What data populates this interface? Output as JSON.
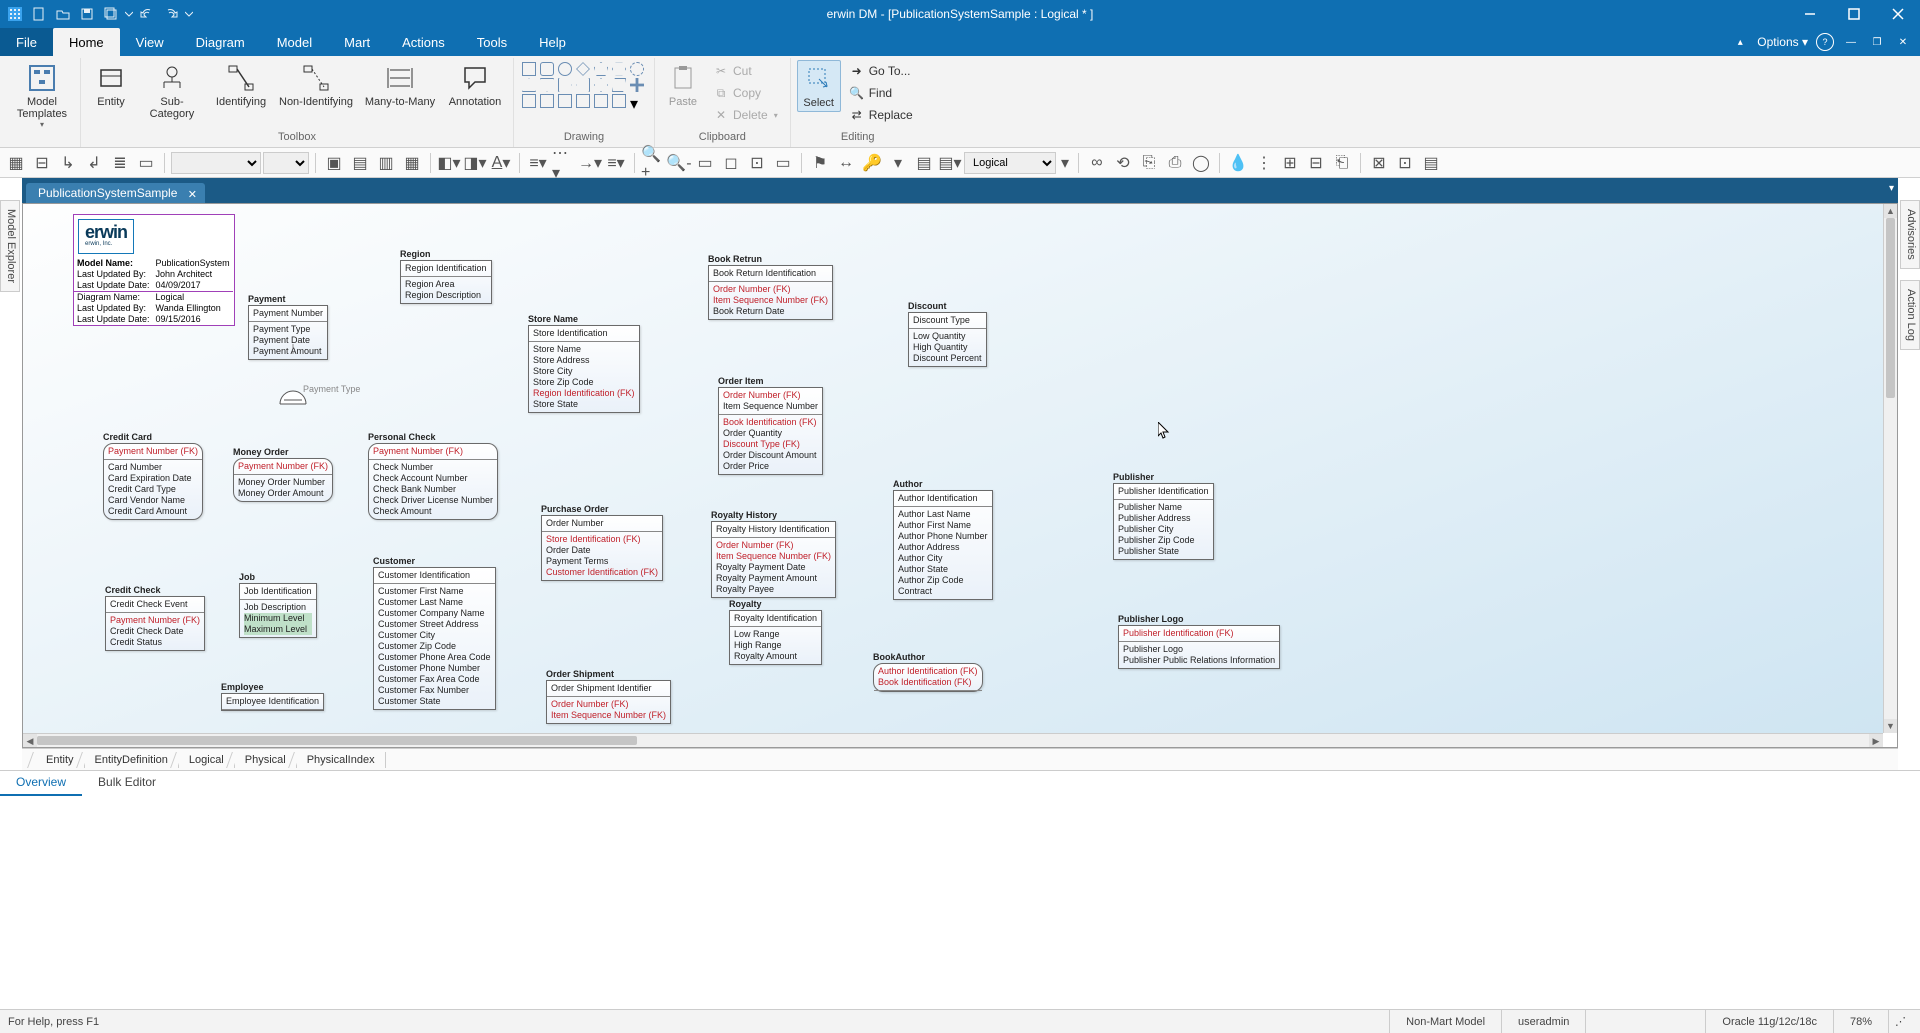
{
  "app": {
    "title": "erwin DM - [PublicationSystemSample : Logical * ]",
    "options_label": "Options"
  },
  "menus": {
    "file": "File",
    "home": "Home",
    "view": "View",
    "diagram": "Diagram",
    "model": "Model",
    "mart": "Mart",
    "actions": "Actions",
    "tools": "Tools",
    "help": "Help"
  },
  "ribbon": {
    "model_templates": "Model\nTemplates",
    "entity": "Entity",
    "sub_category": "Sub-Category",
    "identifying": "Identifying",
    "non_identifying": "Non-Identifying",
    "many_to_many": "Many-to-Many",
    "annotation": "Annotation",
    "toolbox_label": "Toolbox",
    "drawing_label": "Drawing",
    "paste": "Paste",
    "cut": "Cut",
    "copy": "Copy",
    "delete": "Delete",
    "clipboard_label": "Clipboard",
    "select": "Select",
    "goto": "Go To...",
    "find": "Find",
    "replace": "Replace",
    "editing_label": "Editing"
  },
  "toolbar2": {
    "view_dropdown": "Logical"
  },
  "side_panels": {
    "model_explorer": "Model Explorer",
    "advisories": "Advisories",
    "action_log": "Action Log"
  },
  "doc_tab": "PublicationSystemSample",
  "info_box": {
    "logo_text": "erwin",
    "logo_sub": "erwin, Inc.",
    "rows": [
      [
        "Model Name:",
        "PublicationSystem"
      ],
      [
        "Last Updated By:",
        "John Architect"
      ],
      [
        "Last Update Date:",
        "04/09/2017"
      ],
      [
        "Diagram Name:",
        "Logical"
      ],
      [
        "Last Updated By:",
        "Wanda Ellington"
      ],
      [
        "Last Update Date:",
        "09/15/2016"
      ]
    ]
  },
  "free_label": {
    "payment_type": "Payment Type"
  },
  "entities": {
    "region": {
      "name": "Region",
      "pk": [
        "Region Identification"
      ],
      "attrs": [
        "Region Area",
        "Region Description"
      ]
    },
    "payment": {
      "name": "Payment",
      "pk": [
        "Payment Number"
      ],
      "attrs": [
        "Payment Type",
        "Payment Date",
        "Payment Amount"
      ]
    },
    "store": {
      "name": "Store Name",
      "pk": [
        "Store Identification"
      ],
      "attrs": [
        "Store Name",
        "Store Address",
        "Store City",
        "Store Zip Code",
        {
          "t": "Region Identification (FK)",
          "fk": true
        },
        "Store State"
      ]
    },
    "book_return": {
      "name": "Book Retrun",
      "pk": [
        "Book Return Identification"
      ],
      "attrs": [
        {
          "t": "Order Number (FK)",
          "fk": true
        },
        {
          "t": "Item Sequence Number (FK)",
          "fk": true
        },
        "Book Return Date"
      ]
    },
    "discount": {
      "name": "Discount",
      "pk": [
        "Discount Type"
      ],
      "attrs": [
        "Low Quantity",
        "High Quantity",
        "Discount Percent"
      ]
    },
    "credit_card": {
      "name": "Credit Card",
      "pk": [
        {
          "t": "Payment Number (FK)",
          "fk": true
        }
      ],
      "attrs": [
        "Card Number",
        "Card Expiration Date",
        "Credit Card Type",
        "Card Vendor Name",
        "Credit Card Amount"
      ]
    },
    "money_order": {
      "name": "Money Order",
      "pk": [
        {
          "t": "Payment Number (FK)",
          "fk": true
        }
      ],
      "attrs": [
        "Money Order Number",
        "Money Order Amount"
      ]
    },
    "personal_check": {
      "name": "Personal Check",
      "pk": [
        {
          "t": "Payment Number (FK)",
          "fk": true
        }
      ],
      "attrs": [
        "Check Number",
        "Check Account Number",
        "Check Bank Number",
        "Check Driver License Number",
        "Check Amount"
      ]
    },
    "order_item": {
      "name": "Order Item",
      "pk": [
        {
          "t": "Order Number (FK)",
          "fk": true
        },
        "Item Sequence Number"
      ],
      "attrs": [
        {
          "t": "Book Identification (FK)",
          "fk": true
        },
        "Order Quantity",
        {
          "t": "Discount Type (FK)",
          "fk": true
        },
        "Order Discount Amount",
        "Order Price"
      ]
    },
    "purchase_order": {
      "name": "Purchase Order",
      "pk": [
        "Order Number"
      ],
      "attrs": [
        {
          "t": "Store Identification (FK)",
          "fk": true
        },
        "Order Date",
        "Payment Terms",
        {
          "t": "Customer Identification (FK)",
          "fk": true
        }
      ]
    },
    "royalty_history": {
      "name": "Royalty History",
      "pk": [
        "Royalty History Identification"
      ],
      "attrs": [
        {
          "t": "Order Number (FK)",
          "fk": true
        },
        {
          "t": "Item Sequence Number (FK)",
          "fk": true
        },
        "Royalty Payment Date",
        "Royalty Payment Amount",
        "Royalty Payee"
      ]
    },
    "author": {
      "name": "Author",
      "pk": [
        "Author Identification"
      ],
      "attrs": [
        "Author Last Name",
        "Author First Name",
        "Author Phone Number",
        "Author Address",
        "Author City",
        "Author State",
        "Author Zip Code",
        "Contract"
      ]
    },
    "publisher": {
      "name": "Publisher",
      "pk": [
        "Publisher Identification"
      ],
      "attrs": [
        "Publisher Name",
        "Publisher Address",
        "Publisher City",
        "Publisher Zip Code",
        "Publisher State"
      ]
    },
    "credit_check": {
      "name": "Credit Check",
      "pk": [
        "Credit Check Event"
      ],
      "attrs": [
        {
          "t": "Payment Number (FK)",
          "fk": true
        },
        "Credit Check Date",
        "Credit Status"
      ]
    },
    "job": {
      "name": "Job",
      "pk": [
        "Job Identification"
      ],
      "attrs": [
        "Job Description",
        "Minimum Level",
        "Maximum Level"
      ]
    },
    "customer": {
      "name": "Customer",
      "pk": [
        "Customer Identification"
      ],
      "attrs": [
        "Customer First Name",
        "Customer Last Name",
        "Customer Company Name",
        "Customer Street Address",
        "Customer City",
        "Customer Zip Code",
        "Customer Phone Area Code",
        "Customer Phone Number",
        "Customer Fax Area Code",
        "Customer Fax Number",
        "Customer State"
      ]
    },
    "royalty": {
      "name": "Royalty",
      "pk": [
        "Royalty Identification"
      ],
      "attrs": [
        "Low Range",
        "High Range",
        "Royalty Amount"
      ]
    },
    "publisher_logo": {
      "name": "Publisher Logo",
      "pk": [
        {
          "t": "Publisher Identification (FK)",
          "fk": true
        }
      ],
      "attrs": [
        "Publisher Logo",
        "Publisher Public Relations Information"
      ]
    },
    "book_author": {
      "name": "BookAuthor",
      "pk": [
        {
          "t": "Author Identification (FK)",
          "fk": true
        },
        {
          "t": "Book Identification (FK)",
          "fk": true
        }
      ],
      "attrs": []
    },
    "employee": {
      "name": "Employee",
      "pk": [
        "Employee Identification"
      ],
      "attrs": []
    },
    "order_shipment": {
      "name": "Order Shipment",
      "pk": [
        "Order Shipment Identifier"
      ],
      "attrs": [
        {
          "t": "Order Number (FK)",
          "fk": true
        },
        {
          "t": "Item Sequence Number (FK)",
          "fk": true
        }
      ]
    }
  },
  "diagram_tabs": [
    "Entity",
    "EntityDefinition",
    "Logical",
    "Physical",
    "PhysicalIndex"
  ],
  "lower_tabs": {
    "overview": "Overview",
    "bulk": "Bulk Editor"
  },
  "statusbar": {
    "help": "For Help, press F1",
    "mart": "Non-Mart Model",
    "user": "useradmin",
    "db": "Oracle 11g/12c/18c",
    "zoom": "78%"
  }
}
